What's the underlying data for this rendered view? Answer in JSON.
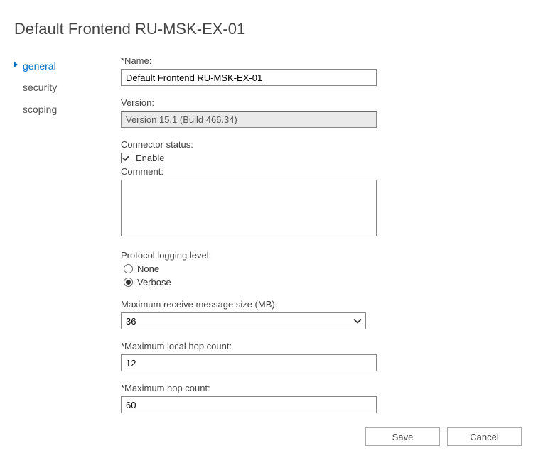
{
  "page_title": "Default Frontend RU-MSK-EX-01",
  "sidebar": {
    "items": [
      {
        "label": "general",
        "active": true
      },
      {
        "label": "security",
        "active": false
      },
      {
        "label": "scoping",
        "active": false
      }
    ]
  },
  "form": {
    "name_label": "*Name:",
    "name_value": "Default Frontend RU-MSK-EX-01",
    "version_label": "Version:",
    "version_value": "Version 15.1 (Build 466.34)",
    "connector_status_label": "Connector status:",
    "enable_label": "Enable",
    "enable_checked": true,
    "comment_label": "Comment:",
    "comment_value": "",
    "logging_label": "Protocol logging level:",
    "logging_options": {
      "none": "None",
      "verbose": "Verbose"
    },
    "logging_selected": "verbose",
    "max_receive_label": "Maximum receive message size (MB):",
    "max_receive_value": "36",
    "max_local_hop_label": "*Maximum local hop count:",
    "max_local_hop_value": "12",
    "max_hop_label": "*Maximum hop count:",
    "max_hop_value": "60"
  },
  "buttons": {
    "save": "Save",
    "cancel": "Cancel"
  }
}
